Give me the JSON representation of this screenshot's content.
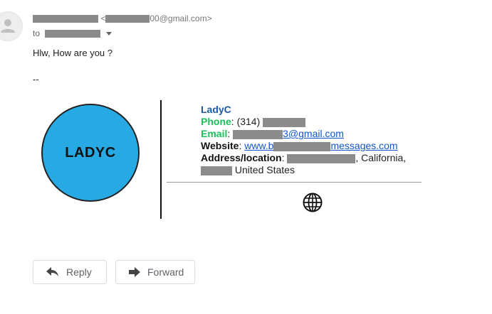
{
  "header": {
    "sender_email_suffix": "00@gmail.com>",
    "recipient_prefix": "to"
  },
  "message": {
    "body": "Hlw, How are you ?",
    "signature_separator": "--"
  },
  "signature": {
    "logo_text": "LADYC",
    "name": "LadyC",
    "phone_label": "Phone",
    "phone_sep": ": ",
    "phone_visible": "(314)",
    "email_label": "Email",
    "email_sep": ": ",
    "email_visible_suffix": "3@gmail.com",
    "website_label": "Website",
    "website_sep": ": ",
    "website_visible_prefix": "www.b",
    "website_visible_suffix": "messages.com",
    "address_label": "Address/location",
    "address_sep": ": ",
    "address_state": ", California,",
    "address_country": "United States"
  },
  "actions": {
    "reply_label": "Reply",
    "forward_label": "Forward"
  },
  "icons": {
    "avatar": "person-icon",
    "expand": "caret-down-icon",
    "social": "globe-icon",
    "reply": "reply-arrow-icon",
    "forward": "forward-arrow-icon"
  },
  "colors": {
    "logo_fill": "#27a9e3",
    "name": "#1c5aa6",
    "contact_labels": "#1dbf5b",
    "link": "#1155cc"
  }
}
